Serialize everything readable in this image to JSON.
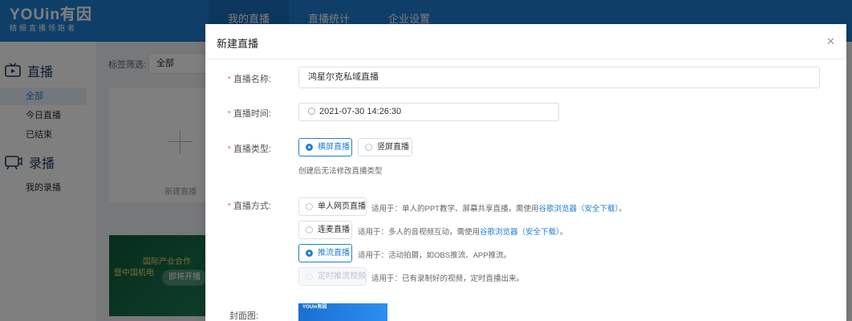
{
  "app": {
    "logo_main": "YOUin有因",
    "logo_sub": "精细直播领跑者"
  },
  "topnav": {
    "items": [
      {
        "label": "我的直播",
        "active": true
      },
      {
        "label": "直播统计",
        "active": false
      },
      {
        "label": "企业设置",
        "active": false
      }
    ]
  },
  "sidebar": {
    "live_header": "直播",
    "live_items": [
      {
        "label": "全部",
        "active": true
      },
      {
        "label": "今日直播",
        "active": false
      },
      {
        "label": "已结束",
        "active": false
      }
    ],
    "record_header": "录播",
    "record_items": [
      {
        "label": "我的录播",
        "active": false
      }
    ]
  },
  "content": {
    "filter_label": "标签筛选:",
    "filter_value": "全部",
    "create_label": "新建直播",
    "banner_line1": "国际产业合作",
    "banner_line2": "暨中国机电",
    "banner_button": "即将开播"
  },
  "dialog": {
    "title": "新建直播",
    "close_icon": "close-icon",
    "name": {
      "label": "直播名称:",
      "value": "鸿星尔克私域直播"
    },
    "time": {
      "label": "直播时间:",
      "value": "2021-07-30 14:26:30"
    },
    "type": {
      "label": "直播类型:",
      "options": [
        {
          "label": "横屏直播",
          "checked": true
        },
        {
          "label": "竖屏直播",
          "checked": false
        }
      ],
      "hint": "创建后无法修改直播类型"
    },
    "method": {
      "label": "直播方式:",
      "options": [
        {
          "label": "单人网页直播",
          "checked": false,
          "disabled": false,
          "hint_prefix": "适用于：单人的PPT教学、屏幕共享直播，需使用",
          "hint_link": "谷歌浏览器（安全下载）",
          "hint_suffix": "。"
        },
        {
          "label": "连麦直播",
          "checked": false,
          "disabled": false,
          "hint_prefix": "适用于：多人的音视频互动，需使用",
          "hint_link": "谷歌浏览器（安全下载）",
          "hint_suffix": "。"
        },
        {
          "label": "推流直播",
          "checked": true,
          "disabled": false,
          "hint_prefix": "适用于：活动拍摄，如OBS推流、APP推流。",
          "hint_link": "",
          "hint_suffix": ""
        },
        {
          "label": "定时推流视频",
          "checked": false,
          "disabled": true,
          "hint_prefix": "适用于：已有录制好的视频，定时直播出来。",
          "hint_link": "",
          "hint_suffix": ""
        }
      ]
    },
    "cover": {
      "label": "封面图:",
      "logo_text": "YOUin有因"
    }
  },
  "colors": {
    "brand": "#1f7fd2",
    "required": "#f56c6c",
    "overlay": "rgba(0,0,0,0.5)"
  }
}
